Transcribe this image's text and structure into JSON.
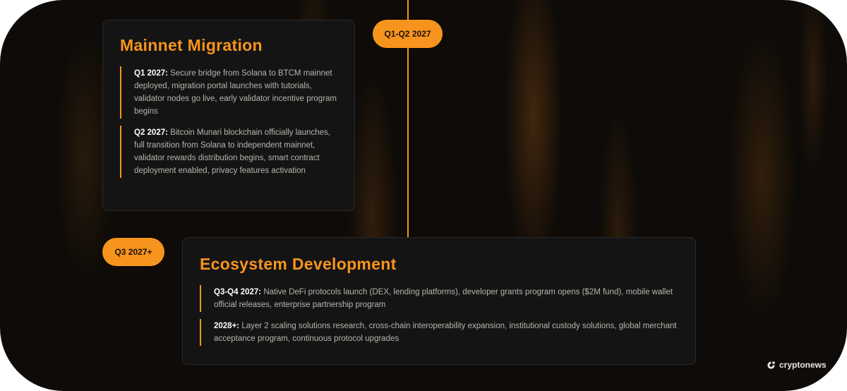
{
  "timeline": {
    "phases": [
      {
        "badge": "Q1-Q2 2027",
        "title": "Mainnet Migration",
        "entries": [
          {
            "label": "Q1 2027:",
            "text": " Secure bridge from Solana to BTCM mainnet deployed, migration portal launches with tutorials, validator nodes go live, early validator incentive program begins"
          },
          {
            "label": "Q2 2027:",
            "text": " Bitcoin Munari blockchain officially launches, full transition from Solana to independent mainnet, validator rewards distribution begins, smart contract deployment enabled, privacy features activation"
          }
        ]
      },
      {
        "badge": "Q3 2027+",
        "title": "Ecosystem Development",
        "entries": [
          {
            "label": "Q3-Q4 2027:",
            "text": " Native DeFi protocols launch (DEX, lending platforms), developer grants program opens ($2M fund), mobile wallet official releases, enterprise partnership program"
          },
          {
            "label": "2028+:",
            "text": " Layer 2 scaling solutions research, cross-chain interoperability expansion, institutional custody solutions, global merchant acceptance program, continuous protocol upgrades"
          }
        ]
      }
    ]
  },
  "watermark": {
    "text": "cryptonews",
    "icon": "cryptonews-logo-icon"
  },
  "colors": {
    "accent": "#f7941d",
    "background": "#0e0b08",
    "card": "#141414"
  }
}
